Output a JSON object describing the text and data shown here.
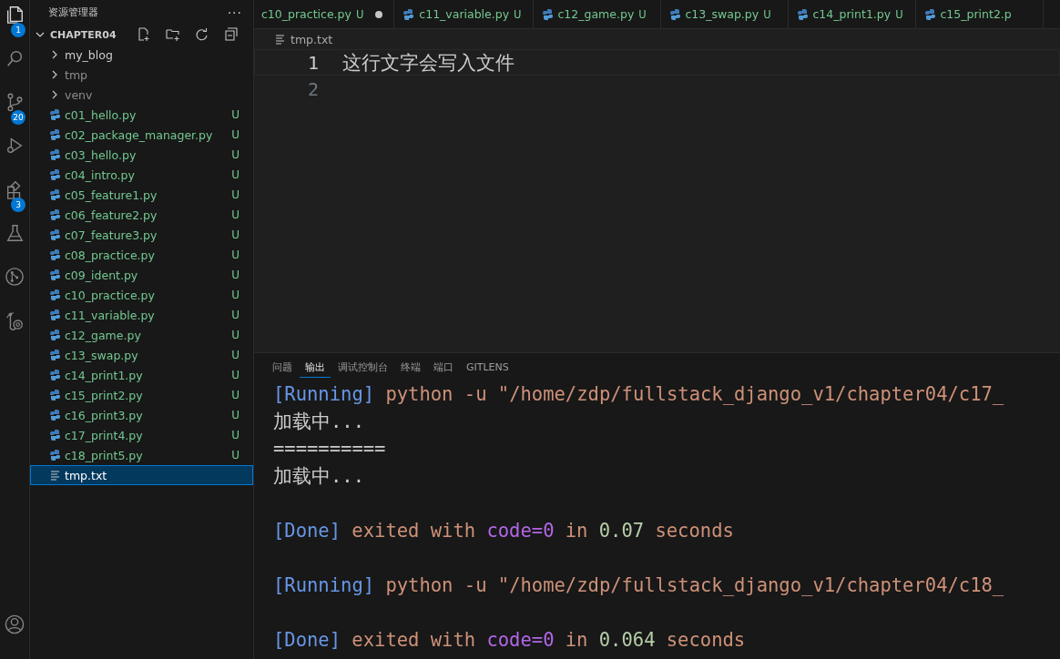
{
  "activity_bar": {
    "items": [
      {
        "kind": "explorer",
        "badge": "1",
        "selected": true
      },
      {
        "kind": "search",
        "selected": false
      },
      {
        "kind": "source-control",
        "badge": "20",
        "selected": false
      },
      {
        "kind": "run",
        "selected": false
      },
      {
        "kind": "extensions",
        "badge": "3",
        "selected": false
      },
      {
        "kind": "testing",
        "selected": false
      },
      {
        "kind": "git-graph",
        "selected": false
      },
      {
        "kind": "remote",
        "selected": false
      }
    ],
    "bottom_items": [
      {
        "kind": "account",
        "selected": false
      }
    ]
  },
  "sidebar": {
    "title": "资源管理器",
    "more": "···",
    "section": {
      "title": "CHAPTER04",
      "expanded": true,
      "items": [
        {
          "kind": "folder",
          "name": "my_blog",
          "expanded": false,
          "ignored": false,
          "selected": false
        },
        {
          "kind": "folder",
          "name": "tmp",
          "expanded": false,
          "ignored": true,
          "selected": false
        },
        {
          "kind": "folder",
          "name": "venv",
          "expanded": false,
          "ignored": true,
          "selected": false
        },
        {
          "kind": "python",
          "name": "c01_hello.py",
          "status": "U",
          "selected": false
        },
        {
          "kind": "python",
          "name": "c02_package_manager.py",
          "status": "U",
          "selected": false
        },
        {
          "kind": "python",
          "name": "c03_hello.py",
          "status": "U",
          "selected": false
        },
        {
          "kind": "python",
          "name": "c04_intro.py",
          "status": "U",
          "selected": false
        },
        {
          "kind": "python",
          "name": "c05_feature1.py",
          "status": "U",
          "selected": false
        },
        {
          "kind": "python",
          "name": "c06_feature2.py",
          "status": "U",
          "selected": false
        },
        {
          "kind": "python",
          "name": "c07_feature3.py",
          "status": "U",
          "selected": false
        },
        {
          "kind": "python",
          "name": "c08_practice.py",
          "status": "U",
          "selected": false
        },
        {
          "kind": "python",
          "name": "c09_ident.py",
          "status": "U",
          "selected": false
        },
        {
          "kind": "python",
          "name": "c10_practice.py",
          "status": "U",
          "selected": false
        },
        {
          "kind": "python",
          "name": "c11_variable.py",
          "status": "U",
          "selected": false
        },
        {
          "kind": "python",
          "name": "c12_game.py",
          "status": "U",
          "selected": false
        },
        {
          "kind": "python",
          "name": "c13_swap.py",
          "status": "U",
          "selected": false
        },
        {
          "kind": "python",
          "name": "c14_print1.py",
          "status": "U",
          "selected": false
        },
        {
          "kind": "python",
          "name": "c15_print2.py",
          "status": "U",
          "selected": false
        },
        {
          "kind": "python",
          "name": "c16_print3.py",
          "status": "U",
          "selected": false
        },
        {
          "kind": "python",
          "name": "c17_print4.py",
          "status": "U",
          "selected": false
        },
        {
          "kind": "python",
          "name": "c18_print5.py",
          "status": "U",
          "selected": false
        },
        {
          "kind": "text",
          "name": "tmp.txt",
          "selected": true
        }
      ]
    }
  },
  "tabs": [
    {
      "name": "c10_practice.py",
      "status": "U",
      "modified": true
    },
    {
      "name": "c11_variable.py",
      "status": "U",
      "modified": false
    },
    {
      "name": "c12_game.py",
      "status": "U",
      "modified": false
    },
    {
      "name": "c13_swap.py",
      "status": "U",
      "modified": false
    },
    {
      "name": "c14_print1.py",
      "status": "U",
      "modified": false
    },
    {
      "name": "c15_print2.p",
      "modified": false
    }
  ],
  "editor": {
    "breadcrumb": "tmp.txt",
    "lines": [
      {
        "number": "1",
        "text": "这行文字会写入文件",
        "current": true
      },
      {
        "number": "2",
        "current": false
      }
    ]
  },
  "panel": {
    "tabs": [
      {
        "label": "问题",
        "selected": false
      },
      {
        "label": "输出",
        "selected": true
      },
      {
        "label": "调试控制台",
        "selected": false
      },
      {
        "label": "终端",
        "selected": false
      },
      {
        "label": "端口",
        "selected": false
      },
      {
        "label": "GITLENS",
        "selected": false
      }
    ],
    "output": [
      {
        "kind": "line",
        "segments": [
          {
            "kind": "tag",
            "text": "[Running]"
          },
          {
            "kind": "text",
            "text": "python -u \"/home/zdp/fullstack_django_v1/chapter04/c17_"
          }
        ]
      },
      {
        "kind": "line",
        "segments": [
          {
            "kind": "plain",
            "text": "加载中..."
          }
        ]
      },
      {
        "kind": "line",
        "segments": [
          {
            "kind": "plain",
            "text": "=========="
          }
        ]
      },
      {
        "kind": "line",
        "segments": [
          {
            "kind": "plain",
            "text": "加载中..."
          }
        ]
      },
      {
        "kind": "blank"
      },
      {
        "kind": "line",
        "segments": [
          {
            "kind": "tag",
            "text": "[Done]"
          },
          {
            "kind": "text",
            "text": "exited with"
          },
          {
            "kind": "keyword",
            "text": "code=0"
          },
          {
            "kind": "text",
            "text": "in"
          },
          {
            "kind": "number",
            "text": "0.07"
          },
          {
            "kind": "text",
            "text": "seconds"
          }
        ]
      },
      {
        "kind": "blank"
      },
      {
        "kind": "line",
        "segments": [
          {
            "kind": "tag",
            "text": "[Running]"
          },
          {
            "kind": "text",
            "text": "python -u \"/home/zdp/fullstack_django_v1/chapter04/c18_"
          }
        ]
      },
      {
        "kind": "blank"
      },
      {
        "kind": "line",
        "segments": [
          {
            "kind": "tag",
            "text": "[Done]"
          },
          {
            "kind": "text",
            "text": "exited with"
          },
          {
            "kind": "keyword",
            "text": "code=0"
          },
          {
            "kind": "text",
            "text": "in"
          },
          {
            "kind": "number",
            "text": "0.064"
          },
          {
            "kind": "text",
            "text": "seconds"
          }
        ]
      }
    ]
  }
}
